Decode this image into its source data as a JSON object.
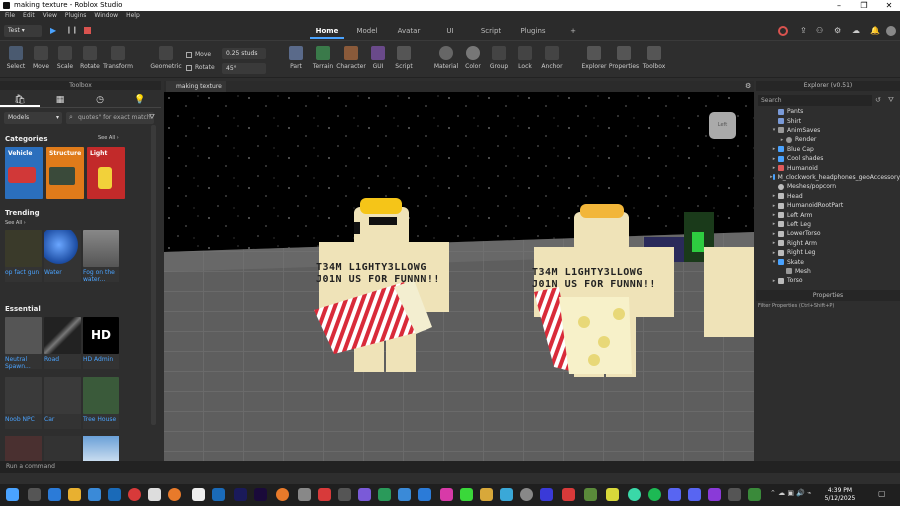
{
  "window": {
    "title": "making texture - Roblox Studio"
  },
  "menu": [
    "File",
    "Edit",
    "View",
    "Plugins",
    "Window",
    "Help"
  ],
  "tabs": {
    "env": "Test",
    "items": [
      "Home",
      "Model",
      "Avatar",
      "UI",
      "Script",
      "Plugins"
    ],
    "active": "Home",
    "add": "+"
  },
  "ribbon": {
    "select": "Select",
    "move": "Move",
    "scale": "Scale",
    "rotate": "Rotate",
    "transform": "Transform",
    "geometric": "Geometric",
    "move_chk": "Move",
    "rotate_chk": "Rotate",
    "move_val": "0.25 studs",
    "rotate_val": "45°",
    "part": "Part",
    "terrain": "Terrain",
    "character": "Character",
    "gui": "GUI",
    "script": "Script",
    "material": "Material",
    "color": "Color",
    "group": "Group",
    "lock": "Lock",
    "anchor": "Anchor",
    "explorer": "Explorer",
    "properties": "Properties",
    "toolbox": "Toolbox"
  },
  "toolbox": {
    "header": "Toolbox",
    "category": "Models",
    "search_placeholder": "quotes\" for exact match",
    "categories_title": "Categories",
    "categories_see_all": "See All ›",
    "categories": [
      {
        "label": "Vehicle",
        "color": "#2b6fbd"
      },
      {
        "label": "Structure",
        "color": "#e07b1a"
      },
      {
        "label": "Light",
        "color": "#c22a2a"
      }
    ],
    "trending_title": "Trending",
    "trending_see_all": "See All ›",
    "trending": [
      {
        "label": "op fact gun"
      },
      {
        "label": "Water"
      },
      {
        "label": "Fog on the water..."
      }
    ],
    "essential_title": "Essential",
    "essential": [
      {
        "label": "Neutral Spawn..."
      },
      {
        "label": "Road"
      },
      {
        "label": "HD Admin"
      },
      {
        "label": "Noob NPC"
      },
      {
        "label": "Car"
      },
      {
        "label": "Tree House"
      }
    ]
  },
  "viewport": {
    "tab": "making texture",
    "shirt_text": "T34M L1GHTY3LLOWG J01N US FOR FUNNN!!",
    "cube_label": "Left"
  },
  "explorer": {
    "header": "Explorer (v0.51)",
    "search": "Search",
    "items": [
      "Pants",
      "Shirt",
      "AnimSaves",
      "Render",
      "Blue Cap",
      "Cool shades",
      "Humanoid",
      "M_clockwork_headphones_geoAccessory",
      "Meshes/popcorn",
      "Head",
      "HumanoidRootPart",
      "Left Arm",
      "Left Leg",
      "LowerTorso",
      "Right Arm",
      "Right Leg",
      "Skate",
      "Mesh",
      "Torso"
    ]
  },
  "properties": {
    "header": "Properties",
    "filter": "Filter Properties (Ctrl+Shift+P)"
  },
  "command": {
    "placeholder": "Run a command"
  },
  "clock": {
    "time": "4:39 PM",
    "date": "5/12/2025"
  },
  "colors": {
    "accent": "#4aa3ff",
    "panel": "#2e2e2e"
  }
}
